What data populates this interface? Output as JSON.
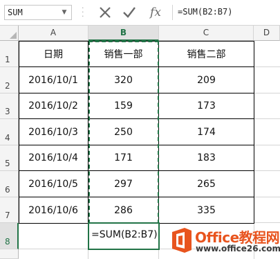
{
  "formula_bar": {
    "name_box": "SUM",
    "name_box_arrow": "▼",
    "dots": "⋮",
    "cancel_icon": "close-icon",
    "confirm_icon": "check-icon",
    "fx_label": "fx",
    "formula": "=SUM(B2:B7)"
  },
  "sheet": {
    "columns": [
      "A",
      "B",
      "C",
      "D"
    ],
    "rows": [
      "1",
      "2",
      "3",
      "4",
      "5",
      "6",
      "7",
      "8"
    ],
    "header": {
      "date": "日期",
      "dept1": "销售一部",
      "dept2": "销售二部"
    },
    "data": [
      {
        "date": "2016/10/1",
        "b": "320",
        "c": "209"
      },
      {
        "date": "2016/10/2",
        "b": "159",
        "c": "173"
      },
      {
        "date": "2016/10/3",
        "b": "250",
        "c": "174"
      },
      {
        "date": "2016/10/4",
        "b": "171",
        "c": "183"
      },
      {
        "date": "2016/10/5",
        "b": "297",
        "c": "265"
      },
      {
        "date": "2016/10/6",
        "b": "286",
        "c": "335"
      }
    ],
    "edit_cell": "=SUM(B2:B7)",
    "accent_color": "#217346"
  },
  "watermark": {
    "brand": "Office教程网",
    "url": "www.office26.com",
    "logo_color": "#e8541e"
  }
}
